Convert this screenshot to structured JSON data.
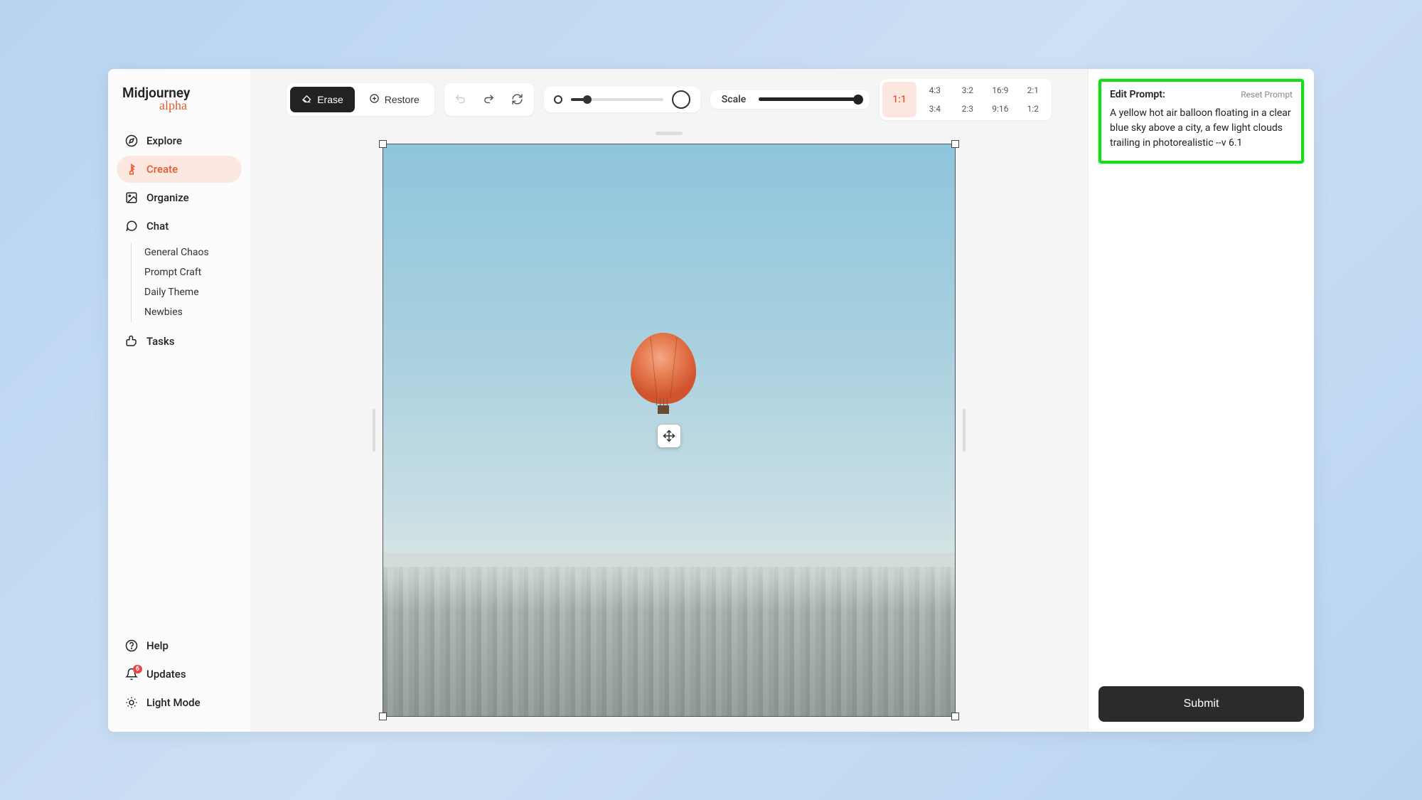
{
  "logo": {
    "main": "Midjourney",
    "sub": "alpha"
  },
  "nav": {
    "explore": "Explore",
    "create": "Create",
    "organize": "Organize",
    "chat": "Chat",
    "tasks": "Tasks",
    "chat_rooms": [
      "General Chaos",
      "Prompt Craft",
      "Daily Theme",
      "Newbies"
    ]
  },
  "footer_nav": {
    "help": "Help",
    "updates": "Updates",
    "updates_badge": "6",
    "light_mode": "Light Mode"
  },
  "toolbar": {
    "erase": "Erase",
    "restore": "Restore",
    "scale_label": "Scale"
  },
  "aspect": {
    "active": "1:1",
    "options": [
      "4:3",
      "3:2",
      "16:9",
      "2:1",
      "3:4",
      "2:3",
      "9:16",
      "1:2"
    ]
  },
  "prompt": {
    "title": "Edit Prompt:",
    "reset": "Reset Prompt",
    "text": "A yellow hot air balloon floating in a clear blue sky above a city, a few light clouds trailing in photorealistic --v 6.1"
  },
  "submit": "Submit"
}
